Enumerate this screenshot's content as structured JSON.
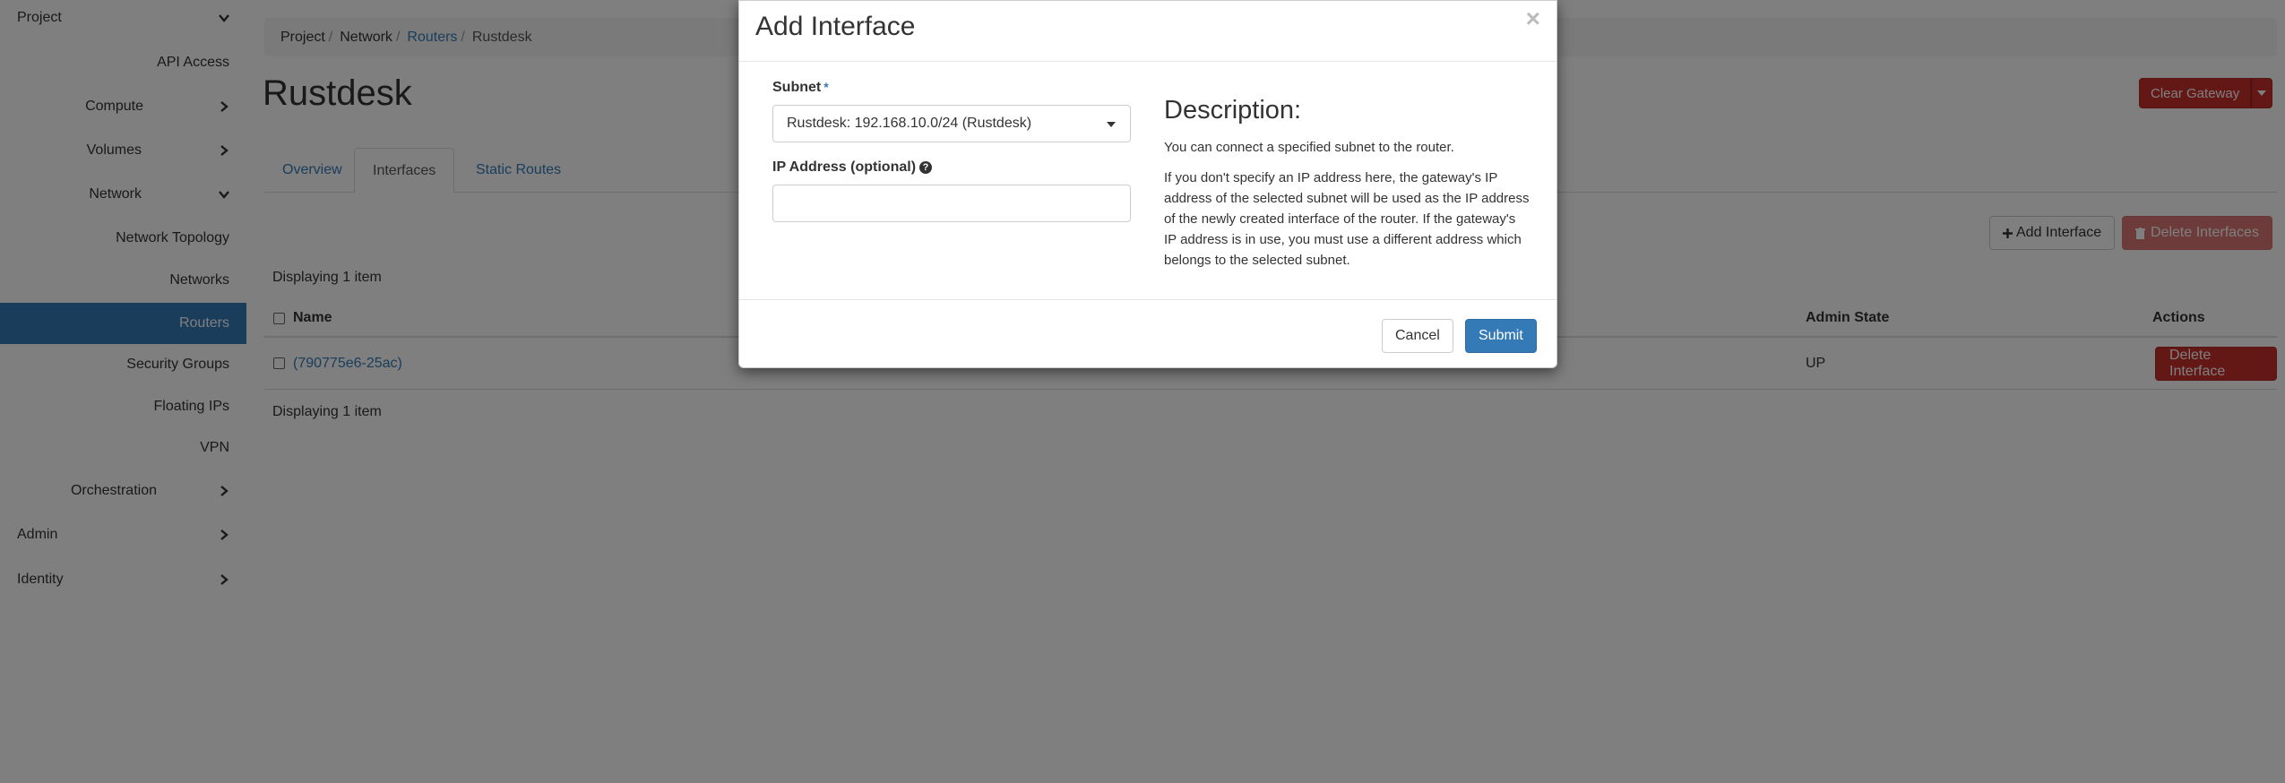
{
  "sidebar": {
    "items": [
      {
        "label": "Project",
        "expandable": true,
        "expanded": true
      },
      {
        "label": "API Access"
      },
      {
        "label": "Compute",
        "expandable": true,
        "expanded": false
      },
      {
        "label": "Volumes",
        "expandable": true,
        "expanded": false
      },
      {
        "label": "Network",
        "expandable": true,
        "expanded": true
      },
      {
        "label": "Network Topology"
      },
      {
        "label": "Networks"
      },
      {
        "label": "Routers",
        "active": true
      },
      {
        "label": "Security Groups"
      },
      {
        "label": "Floating IPs"
      },
      {
        "label": "VPN"
      },
      {
        "label": "Orchestration",
        "expandable": true,
        "expanded": false
      },
      {
        "label": "Admin",
        "expandable": true,
        "expanded": false
      },
      {
        "label": "Identity",
        "expandable": true,
        "expanded": false
      }
    ]
  },
  "breadcrumb": {
    "items": [
      "Project",
      "Network",
      "Routers",
      "Rustdesk"
    ]
  },
  "page": {
    "title": "Rustdesk",
    "clear_gateway_label": "Clear Gateway"
  },
  "tabs": [
    "Overview",
    "Interfaces",
    "Static Routes"
  ],
  "toolbar": {
    "add_interface_label": "Add Interface",
    "delete_interfaces_label": "Delete Interfaces"
  },
  "table": {
    "displaying_top": "Displaying 1 item",
    "displaying_bottom": "Displaying 1 item",
    "headers": {
      "name": "Name",
      "admin_state": "Admin State",
      "actions": "Actions"
    },
    "rows": [
      {
        "name": "(790775e6-25ac)",
        "admin_state": "UP",
        "action_label": "Delete Interface"
      }
    ]
  },
  "modal": {
    "title": "Add Interface",
    "close_glyph": "×",
    "subnet_label": "Subnet",
    "required_marker": "*",
    "subnet_value": "Rustdesk: 192.168.10.0/24 (Rustdesk)",
    "ip_label": "IP Address (optional)",
    "ip_value": "",
    "description_title": "Description:",
    "description_p1": "You can connect a specified subnet to the router.",
    "description_p2": "If you don't specify an IP address here, the gateway's IP address of the selected subnet will be used as the IP address of the newly created interface of the router. If the gateway's IP address is in use, you must use a different address which belongs to the selected subnet.",
    "cancel_label": "Cancel",
    "submit_label": "Submit"
  },
  "colors": {
    "link": "#337ab7",
    "danger": "#c9302c",
    "active_nav": "#337ab7"
  }
}
